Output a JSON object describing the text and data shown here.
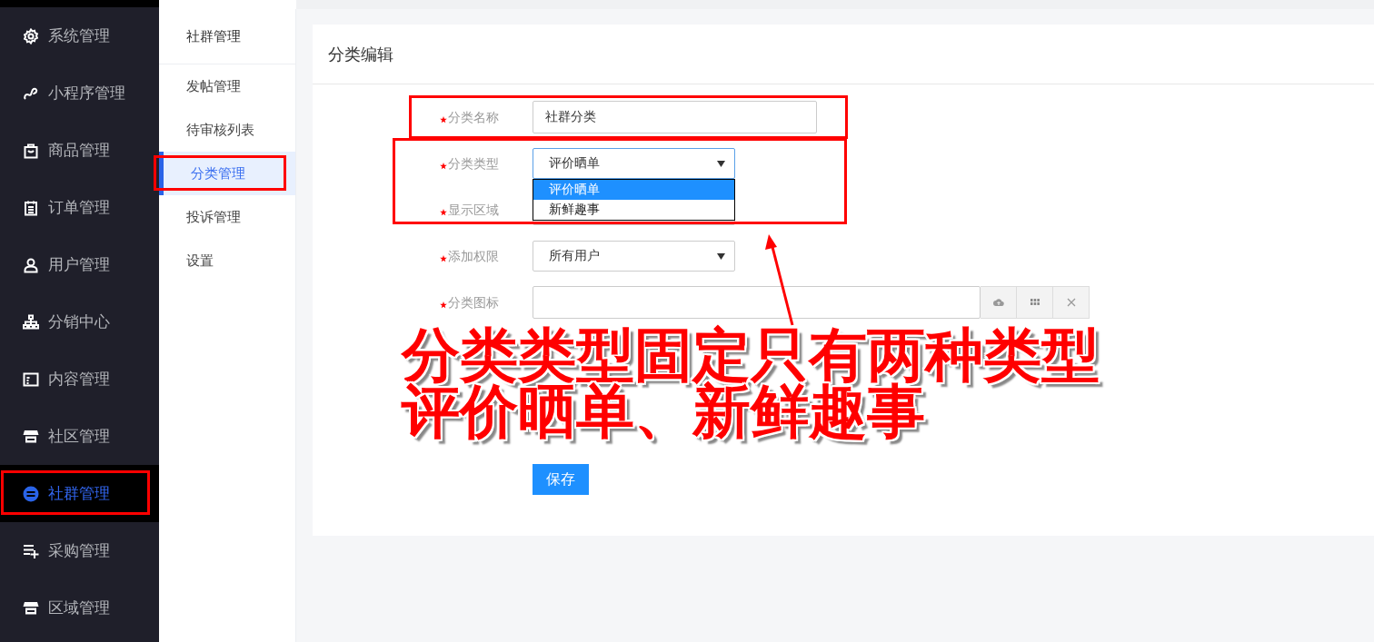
{
  "sidebar": {
    "items": [
      {
        "label": "系统管理",
        "selected": false
      },
      {
        "label": "小程序管理",
        "selected": false
      },
      {
        "label": "商品管理",
        "selected": false
      },
      {
        "label": "订单管理",
        "selected": false
      },
      {
        "label": "用户管理",
        "selected": false
      },
      {
        "label": "分销中心",
        "selected": false
      },
      {
        "label": "内容管理",
        "selected": false
      },
      {
        "label": "社区管理",
        "selected": false
      },
      {
        "label": "社群管理",
        "selected": true
      },
      {
        "label": "采购管理",
        "selected": false
      },
      {
        "label": "区域管理",
        "selected": false
      }
    ]
  },
  "submenu": {
    "title": "社群管理",
    "items": [
      {
        "label": "发帖管理",
        "selected": false
      },
      {
        "label": "待审核列表",
        "selected": false
      },
      {
        "label": "分类管理",
        "selected": true
      },
      {
        "label": "投诉管理",
        "selected": false
      },
      {
        "label": "设置",
        "selected": false
      }
    ]
  },
  "form": {
    "title": "分类编辑",
    "fields": [
      {
        "kind": "text",
        "label": "分类名称",
        "required": true,
        "value": "社群分类"
      },
      {
        "kind": "select",
        "label": "分类类型",
        "required": true,
        "value": "评价晒单",
        "expanded": true,
        "options": [
          {
            "label": "评价晒单",
            "selected": true
          },
          {
            "label": "新鲜趣事",
            "selected": false
          }
        ]
      },
      {
        "kind": "select",
        "label": "显示区域",
        "required": true,
        "expanded": false
      },
      {
        "kind": "select",
        "label": "添加权限",
        "required": true,
        "value": "所有用户",
        "expanded": false
      },
      {
        "kind": "image",
        "label": "分类图标",
        "required": true
      }
    ],
    "save_button": "保存"
  },
  "annotation": {
    "caption": [
      "分类类型固定只有两种类型",
      "评价晒单、新鲜趣事"
    ]
  }
}
